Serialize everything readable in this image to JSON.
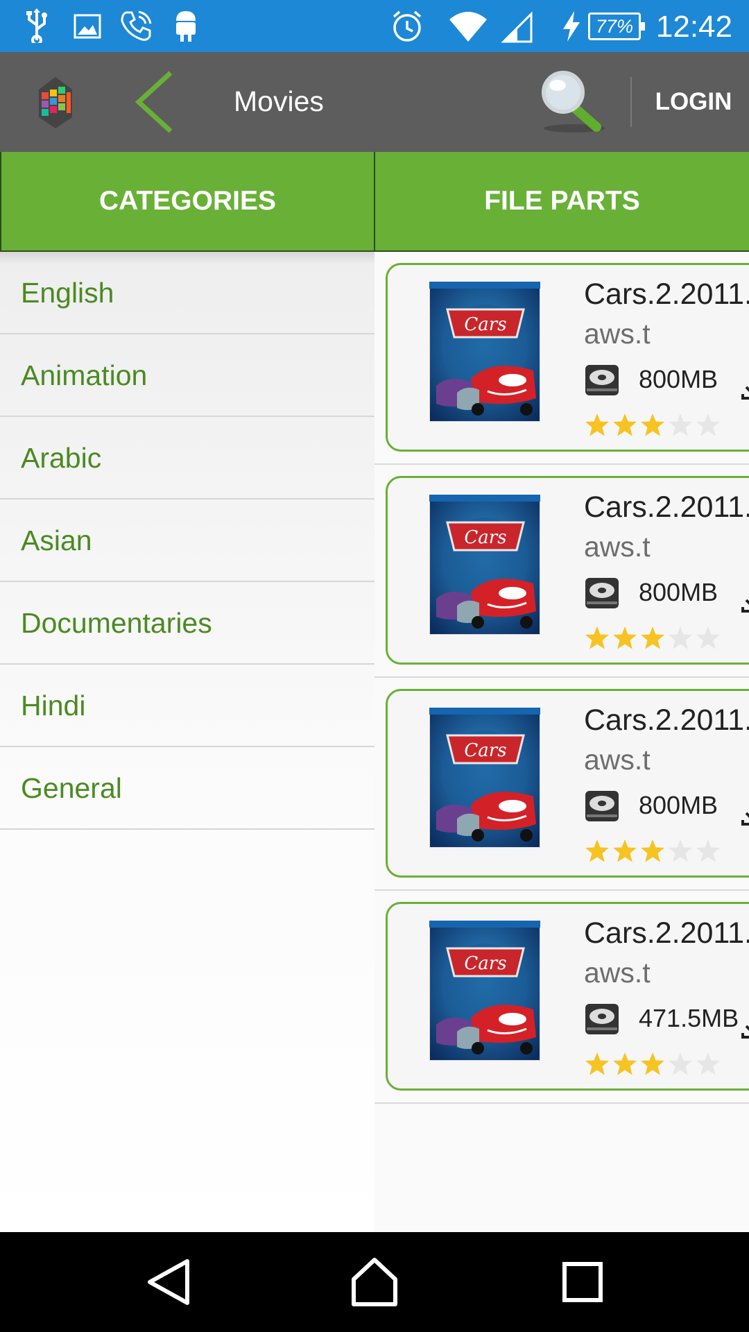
{
  "status_bar": {
    "icons": [
      "usb-icon",
      "image-icon",
      "phone-icon",
      "android-icon",
      "alarm-icon",
      "wifi-icon",
      "signal-icon",
      "charging-icon"
    ],
    "battery": "77%",
    "time": "12:42"
  },
  "toolbar": {
    "title": "Movies",
    "login_label": "LOGIN",
    "back_icon": "chevron-left-icon",
    "search_icon": "search-icon",
    "accent_color": "#69b037"
  },
  "tabs": [
    {
      "label": "CATEGORIES"
    },
    {
      "label": "FILE PARTS"
    }
  ],
  "categories": [
    {
      "label": "English"
    },
    {
      "label": "Animation"
    },
    {
      "label": "Arabic"
    },
    {
      "label": "Asian"
    },
    {
      "label": "Documentaries"
    },
    {
      "label": "Hindi"
    },
    {
      "label": "General"
    }
  ],
  "files": [
    {
      "title": "Cars.2.2011.",
      "host": "aws.t",
      "size": "800MB",
      "rating": 3,
      "max_rating": 5
    },
    {
      "title": "Cars.2.2011.",
      "host": "aws.t",
      "size": "800MB",
      "rating": 3,
      "max_rating": 5
    },
    {
      "title": "Cars.2.2011.",
      "host": "aws.t",
      "size": "800MB",
      "rating": 3,
      "max_rating": 5
    },
    {
      "title": "Cars.2.2011.",
      "host": "aws.t",
      "size": "471.5MB",
      "rating": 3,
      "max_rating": 5
    }
  ],
  "colors": {
    "status_bar": "#1d88d6",
    "toolbar": "#5d5d5d",
    "tab": "#69b037",
    "category_text": "#4b8a22",
    "star_on": "#f6c322",
    "star_off": "#e6e6e6"
  },
  "nav_bar": {
    "icons": [
      "back-triangle-icon",
      "home-icon",
      "recents-icon"
    ]
  }
}
